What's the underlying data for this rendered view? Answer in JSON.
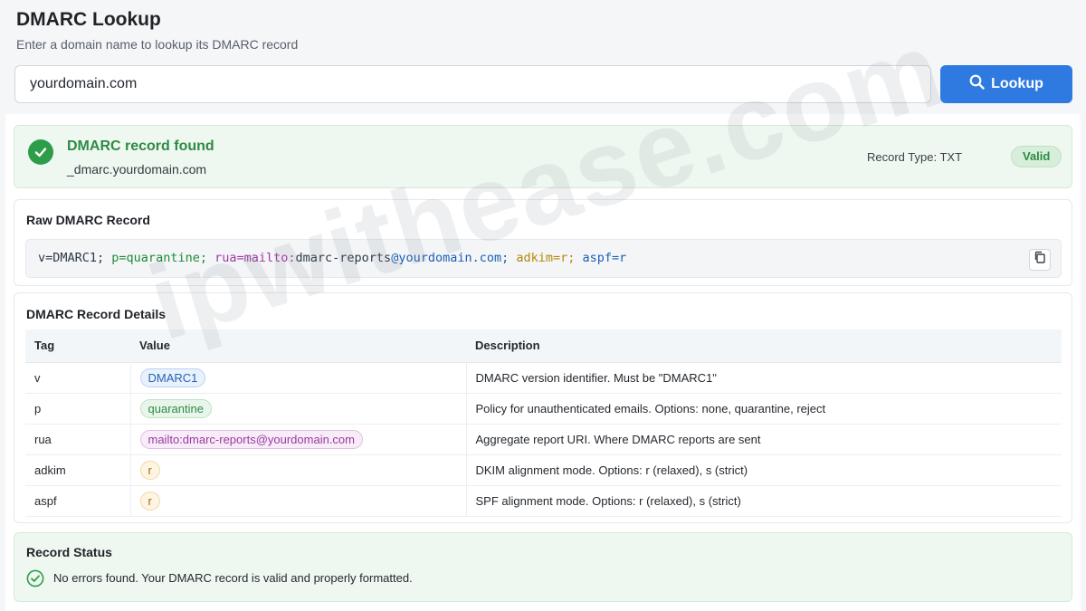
{
  "header": {
    "title": "DMARC Lookup",
    "subtitle": "Enter a domain name to lookup its DMARC record"
  },
  "search": {
    "value": "yourdomain.com",
    "button_label": "Lookup"
  },
  "result": {
    "title": "DMARC record found",
    "domain": "_dmarc.yourdomain.com",
    "record_type": "Record Type: TXT",
    "badge": "Valid"
  },
  "raw": {
    "title": "Raw DMARC Record",
    "tokens": {
      "v": "v=DMARC1;",
      "p": "p=quarantine;",
      "rua_key": "rua=mailto:",
      "rua_local": "dmarc-reports",
      "rua_domain": "@yourdomain.com;",
      "adkim": "adkim=r;",
      "aspf": "aspf=r"
    }
  },
  "details": {
    "title": "DMARC Record Details",
    "headers": {
      "tag": "Tag",
      "value": "Value",
      "description": "Description"
    },
    "rows": [
      {
        "tag": "v",
        "value": "DMARC1",
        "description": "DMARC version identifier. Must be \"DMARC1\""
      },
      {
        "tag": "p",
        "value": "quarantine",
        "description": "Policy for unauthenticated emails. Options: none, quarantine, reject"
      },
      {
        "tag": "rua",
        "value": "mailto:dmarc-reports@yourdomain.com",
        "description": "Aggregate report URI. Where DMARC reports are sent"
      },
      {
        "tag": "adkim",
        "value": "r",
        "description": "DKIM alignment mode. Options: r (relaxed), s (strict)"
      },
      {
        "tag": "aspf",
        "value": "r",
        "description": "SPF alignment mode. Options: r (relaxed), s (strict)"
      }
    ]
  },
  "status": {
    "title": "Record Status",
    "message": "No errors found. Your DMARC record is valid and properly formatted."
  },
  "watermark": "ipwithease.com",
  "colors": {
    "accent": "#2f7ae0",
    "success": "#2e9d4a"
  }
}
